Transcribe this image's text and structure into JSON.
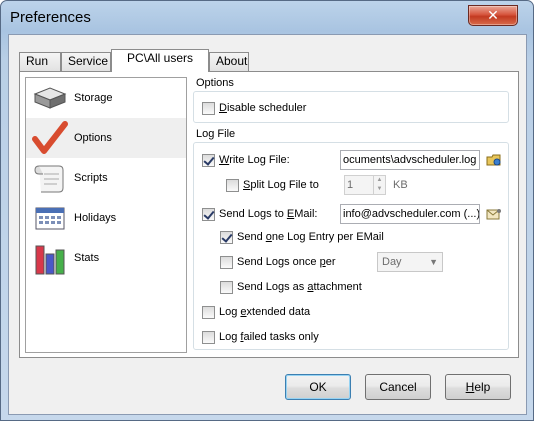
{
  "window": {
    "title": "Preferences",
    "close_glyph": "✕"
  },
  "tabs": [
    {
      "label": "Run"
    },
    {
      "label": "Service"
    },
    {
      "label": "PC\\All users"
    },
    {
      "label": "About"
    }
  ],
  "sidebar": {
    "items": [
      {
        "label": "Storage",
        "icon": "storage-icon"
      },
      {
        "label": "Options",
        "icon": "checkmark-icon"
      },
      {
        "label": "Scripts",
        "icon": "scroll-icon"
      },
      {
        "label": "Holidays",
        "icon": "calendar-icon"
      },
      {
        "label": "Stats",
        "icon": "bar-chart-icon"
      }
    ]
  },
  "options_group": {
    "title": "Options",
    "disable_scheduler": {
      "prefix": "",
      "accel": "D",
      "rest": "isable scheduler",
      "checked": false
    }
  },
  "logfile_group": {
    "title": "Log File",
    "write_log": {
      "accel": "W",
      "rest": "rite Log File:",
      "checked": true,
      "value": "ocuments\\advscheduler.log"
    },
    "split_log": {
      "accel": "S",
      "rest": "plit Log File to",
      "checked": false,
      "value": "1",
      "unit": "KB"
    },
    "send_logs_email": {
      "pre": "Send Logs to ",
      "accel": "E",
      "post": "Mail:",
      "checked": true,
      "value": "info@advscheduler.com (...)"
    },
    "send_one_entry": {
      "pre": "Send ",
      "accel": "o",
      "post": "ne Log Entry per EMail",
      "checked": true
    },
    "send_once_per": {
      "pre": "Send Logs once ",
      "accel": "p",
      "post": "er",
      "checked": false,
      "select_value": "Day"
    },
    "send_as_attachment": {
      "pre": "Send Logs as ",
      "accel": "a",
      "post": "ttachment",
      "checked": false
    },
    "log_extended": {
      "pre": "Log ",
      "accel": "e",
      "post": "xtended data",
      "checked": false
    },
    "log_failed": {
      "pre": "Log ",
      "accel": "f",
      "post": "ailed tasks only",
      "checked": false
    }
  },
  "buttons": {
    "ok": "OK",
    "cancel": "Cancel",
    "help_accel": "H",
    "help_rest": "elp"
  },
  "colors": {
    "accent_red": "#d84c2f",
    "selection": "#efefef"
  }
}
